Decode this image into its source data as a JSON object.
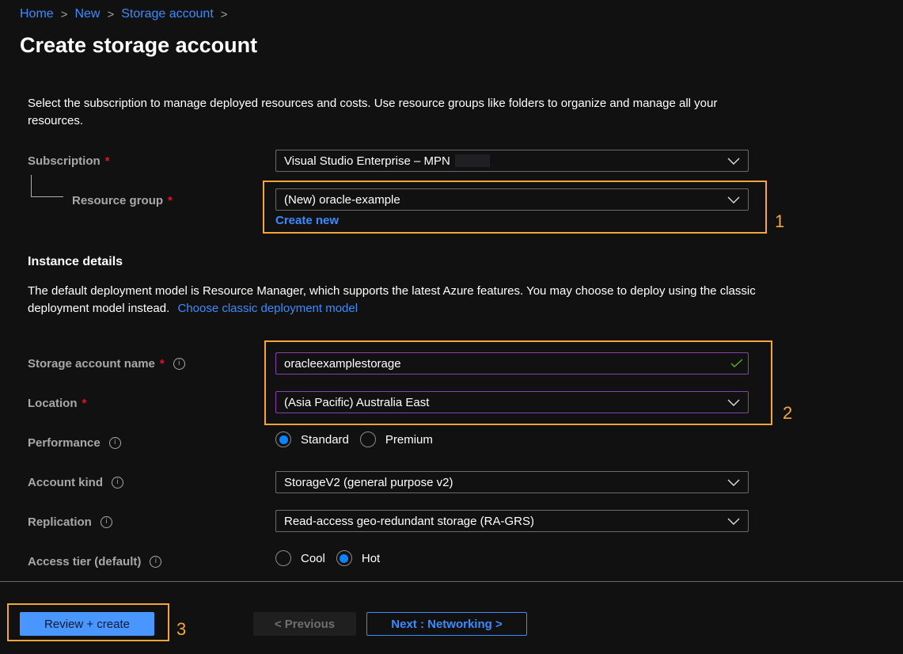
{
  "breadcrumb": [
    {
      "label": "Home"
    },
    {
      "label": "New"
    },
    {
      "label": "Storage account"
    }
  ],
  "breadcrumb_separator": ">",
  "page_title": "Create storage account",
  "project_details": {
    "description": "Select the subscription to manage deployed resources and costs. Use resource groups like folders to organize and manage all your resources.",
    "subscription": {
      "label": "Subscription",
      "required_mark": "*",
      "value": "Visual Studio Enterprise – MPN",
      "icon": "chevron-down-icon"
    },
    "resource_group": {
      "label": "Resource group",
      "required_mark": "*",
      "value": "(New) oracle-example",
      "icon": "chevron-down-icon",
      "create_new_link": "Create new"
    }
  },
  "instance_details": {
    "heading": "Instance details",
    "description": "The default deployment model is Resource Manager, which supports the latest Azure features. You may choose to deploy using the classic deployment model instead.",
    "classic_link": "Choose classic deployment model",
    "storage_account_name": {
      "label": "Storage account name",
      "required_mark": "*",
      "value": "oracleexamplestorage",
      "validation_icon": "checkmark-icon",
      "info_icon": "info-icon"
    },
    "location": {
      "label": "Location",
      "required_mark": "*",
      "value": "(Asia Pacific) Australia East",
      "icon": "chevron-down-icon"
    },
    "performance": {
      "label": "Performance",
      "info_icon": "info-icon",
      "options": [
        {
          "label": "Standard",
          "selected": true
        },
        {
          "label": "Premium",
          "selected": false
        }
      ]
    },
    "account_kind": {
      "label": "Account kind",
      "info_icon": "info-icon",
      "value": "StorageV2 (general purpose v2)",
      "icon": "chevron-down-icon"
    },
    "replication": {
      "label": "Replication",
      "info_icon": "info-icon",
      "value": "Read-access geo-redundant storage (RA-GRS)",
      "icon": "chevron-down-icon"
    },
    "access_tier": {
      "label": "Access tier (default)",
      "info_icon": "info-icon",
      "options": [
        {
          "label": "Cool",
          "selected": false
        },
        {
          "label": "Hot",
          "selected": true
        }
      ]
    }
  },
  "annotations": {
    "callout_1": "1",
    "callout_2": "2",
    "callout_3": "3",
    "highlight_color": "#f7a53b"
  },
  "footer": {
    "review_create_label": "Review + create",
    "previous_label": "< Previous",
    "next_label": "Next : Networking >"
  },
  "colors": {
    "background": "#111111",
    "link": "#3b8bff",
    "primary_button": "#4a96ff",
    "required": "#e81123",
    "radio_selected": "#0a84ff",
    "valid_check": "#5fa82a",
    "focused_border": "#8a3fb0"
  }
}
